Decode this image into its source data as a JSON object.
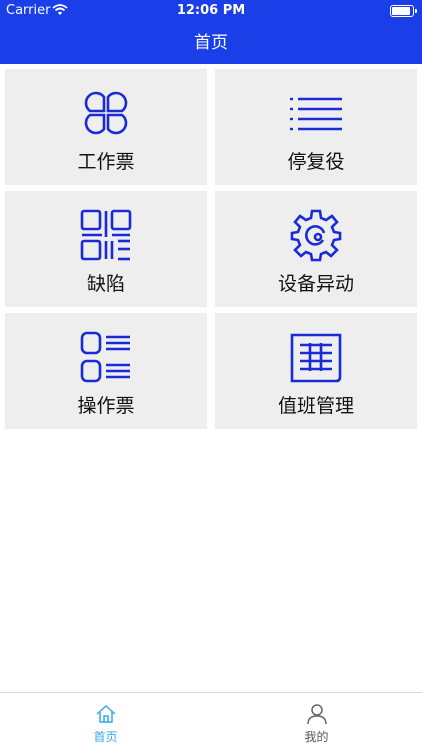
{
  "status_bar": {
    "carrier": "Carrier",
    "time": "12:06 PM"
  },
  "nav": {
    "title": "首页"
  },
  "menu": {
    "items": [
      {
        "label": "工作票",
        "icon": "clover-icon"
      },
      {
        "label": "停复役",
        "icon": "list-icon"
      },
      {
        "label": "缺陷",
        "icon": "qr-code-icon"
      },
      {
        "label": "设备异动",
        "icon": "gear-icon"
      },
      {
        "label": "操作票",
        "icon": "checklist-icon"
      },
      {
        "label": "值班管理",
        "icon": "table-icon"
      }
    ]
  },
  "tabbar": {
    "home_label": "首页",
    "mine_label": "我的"
  },
  "colors": {
    "accent": "#1a3ee8",
    "icon": "#1a2bd6",
    "tab_active": "#35a8f0",
    "tab_inactive": "#666666"
  }
}
